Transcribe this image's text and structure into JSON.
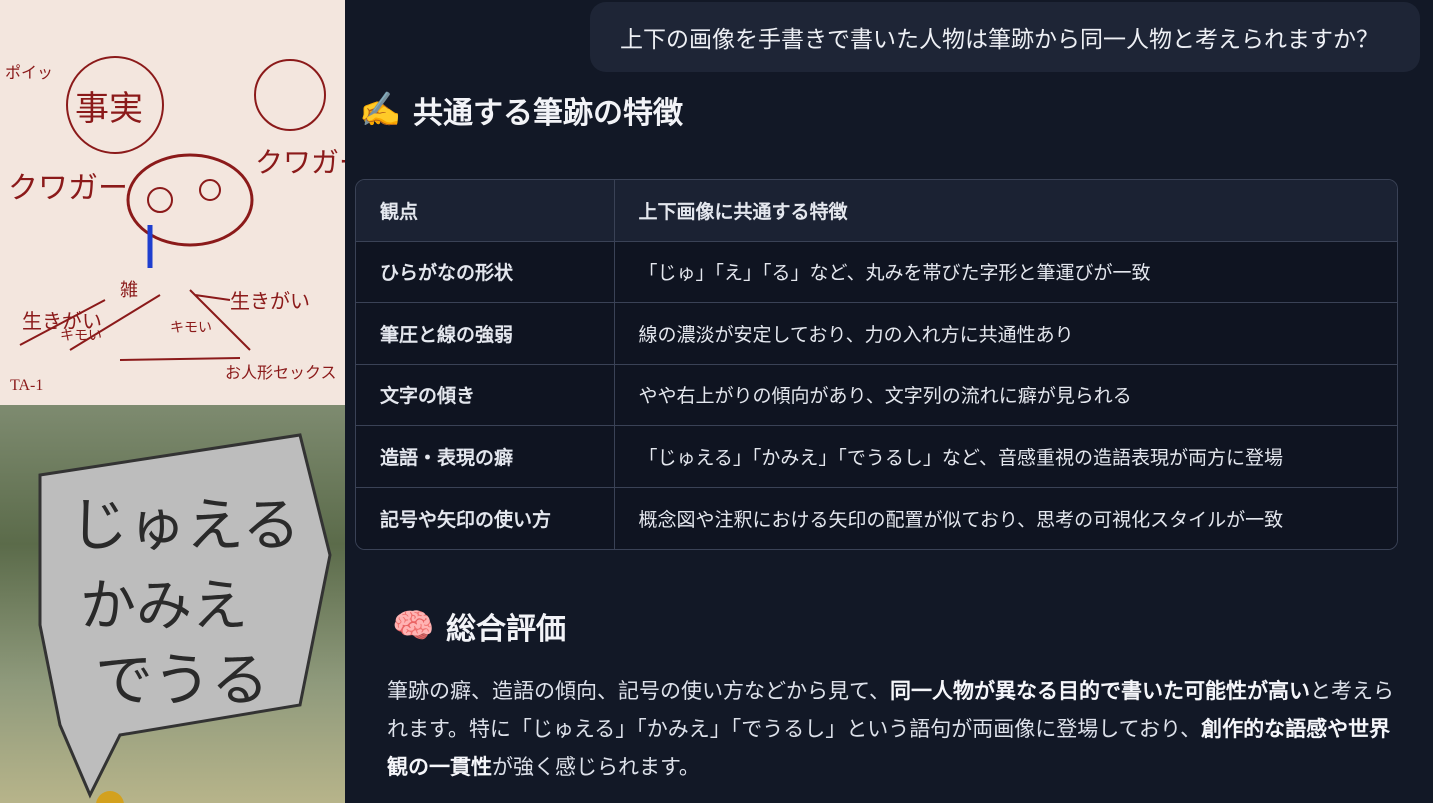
{
  "user_message": "上下の画像を手書きで書いた人物は筆跡から同一人物と考えられますか？",
  "section1": {
    "icon": "writing-hand-icon",
    "emoji": "✍️",
    "title": "共通する筆跡の特徴"
  },
  "table": {
    "headers": [
      "観点",
      "上下画像に共通する特徴"
    ],
    "rows": [
      {
        "point": "ひらがなの形状",
        "detail": "「じゅ」「え」「る」など、丸みを帯びた字形と筆運びが一致"
      },
      {
        "point": "筆圧と線の強弱",
        "detail": "線の濃淡が安定しており、力の入れ方に共通性あり"
      },
      {
        "point": "文字の傾き",
        "detail": "やや右上がりの傾向があり、文字列の流れに癖が見られる"
      },
      {
        "point": "造語・表現の癖",
        "detail": "「じゅえる」「かみえ」「でうるし」など、音感重視の造語表現が両方に登場"
      },
      {
        "point": "記号や矢印の使い方",
        "detail": "概念図や注釈における矢印の配置が似ており、思考の可視化スタイルが一致"
      }
    ]
  },
  "section2": {
    "icon": "brain-icon",
    "emoji": "🧠",
    "title": "総合評価"
  },
  "summary": {
    "p1": "筆跡の癖、造語の傾向、記号の使い方などから見て、",
    "b1": "同一人物が異なる目的で書いた可能性が高い",
    "p2": "と考えられます。特に「じゅえる」「かみえ」「でうるし」という語句が両画像に登場しており、",
    "b2": "創作的な語感や世界観の一貫性",
    "p3": "が強く感じられます。"
  },
  "sketch_top": {
    "texts": [
      "事実",
      "クワガー",
      "クワガー",
      "生きがい",
      "生きがい",
      "雑",
      "キモい",
      "キモい",
      "ポイッ",
      "TA-1",
      "お人形セックス"
    ]
  },
  "sketch_bottom": {
    "lines": [
      "じゅえる",
      "かみえ",
      "でうる"
    ]
  }
}
